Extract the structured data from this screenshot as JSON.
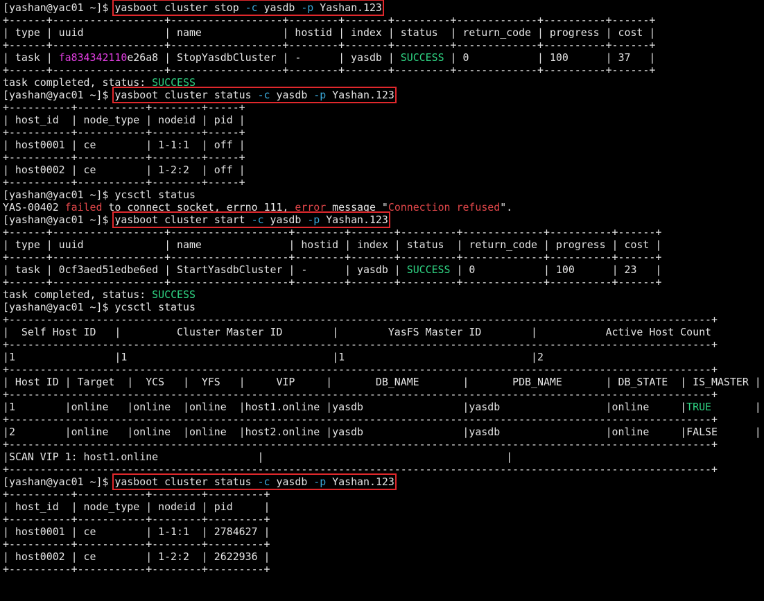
{
  "terminal": {
    "colors": {
      "background": "#000000",
      "foreground": "#e4e4e4",
      "magenta": "#e23ee2",
      "cyan": "#3aa8d8",
      "green": "#2fd483",
      "red": "#e2474a",
      "highlight_box": "#e0282c"
    },
    "lines": [
      [
        {
          "t": "[yashan@yac01 ~]$ "
        },
        {
          "t": "yasboot cluster stop ",
          "box": "s"
        },
        {
          "t": "-c",
          "c": "cyan",
          "box": "m"
        },
        {
          "t": " yasdb ",
          "box": "m"
        },
        {
          "t": "-p",
          "c": "cyan",
          "box": "m"
        },
        {
          "t": " Yashan.123",
          "box": "e"
        }
      ],
      [
        {
          "t": "+------+------------------+------------------+--------+-------+---------+-------------+----------+------+"
        }
      ],
      [
        {
          "t": "| type | uuid             | name             | hostid | index | status  | return_code | progress | cost |"
        }
      ],
      [
        {
          "t": "+------+------------------+------------------+--------+-------+---------+-------------+----------+------+"
        }
      ],
      [
        {
          "t": "| task | "
        },
        {
          "t": "fa834342110",
          "c": "magenta"
        },
        {
          "t": "e26a8 | StopYasdbCluster | -      | yasdb | "
        },
        {
          "t": "SUCCESS",
          "c": "green"
        },
        {
          "t": " | 0           | 100      | 37   |"
        }
      ],
      [
        {
          "t": "+------+------------------+------------------+--------+-------+---------+-------------+----------+------+"
        }
      ],
      [
        {
          "t": "task completed, status: "
        },
        {
          "t": "SUCCESS",
          "c": "green"
        }
      ],
      [
        {
          "t": "[yashan@yac01 ~]$ "
        },
        {
          "t": "yasboot cluster status ",
          "box": "s"
        },
        {
          "t": "-c",
          "c": "cyan",
          "box": "m"
        },
        {
          "t": " yasdb ",
          "box": "m"
        },
        {
          "t": "-p",
          "c": "cyan",
          "box": "m"
        },
        {
          "t": " Yashan.123",
          "box": "e"
        }
      ],
      [
        {
          "t": "+----------+-----------+--------+-----+"
        }
      ],
      [
        {
          "t": "| host_id  | node_type | nodeid | pid |"
        }
      ],
      [
        {
          "t": "+----------+-----------+--------+-----+"
        }
      ],
      [
        {
          "t": "| host0001 | ce        | 1-1:1  | off |"
        }
      ],
      [
        {
          "t": "+----------+-----------+--------+-----+"
        }
      ],
      [
        {
          "t": "| host0002 | ce        | 1-2:2  | off |"
        }
      ],
      [
        {
          "t": "+----------+-----------+--------+-----+"
        }
      ],
      [
        {
          "t": "[yashan@yac01 ~]$ ycsctl status"
        }
      ],
      [
        {
          "t": "YAS-00402 "
        },
        {
          "t": "failed",
          "c": "red"
        },
        {
          "t": " to connect socket, errno 111, "
        },
        {
          "t": "error",
          "c": "red"
        },
        {
          "t": " message \""
        },
        {
          "t": "Connection refused",
          "c": "red"
        },
        {
          "t": "\"."
        }
      ],
      [
        {
          "t": "[yashan@yac01 ~]$ "
        },
        {
          "t": "yasboot cluster start ",
          "box": "s"
        },
        {
          "t": "-c",
          "c": "cyan",
          "box": "m"
        },
        {
          "t": " yasdb ",
          "box": "m"
        },
        {
          "t": "-p",
          "c": "cyan",
          "box": "m"
        },
        {
          "t": " Yashan.123",
          "box": "e"
        }
      ],
      [
        {
          "t": "+------+------------------+-------------------+--------+-------+---------+-------------+----------+------+"
        }
      ],
      [
        {
          "t": "| type | uuid             | name              | hostid | index | status  | return_code | progress | cost |"
        }
      ],
      [
        {
          "t": "+------+------------------+-------------------+--------+-------+---------+-------------+----------+------+"
        }
      ],
      [
        {
          "t": "| task | 0cf3aed51edbe6ed | StartYasdbCluster | -      | yasdb | "
        },
        {
          "t": "SUCCESS",
          "c": "green"
        },
        {
          "t": " | 0           | 100      | 23   |"
        }
      ],
      [
        {
          "t": "+------+------------------+-------------------+--------+-------+---------+-------------+----------+------+"
        }
      ],
      [
        {
          "t": "task completed, status: "
        },
        {
          "t": "SUCCESS",
          "c": "green"
        }
      ],
      [
        {
          "t": "[yashan@yac01 ~]$ ycsctl status"
        }
      ],
      [
        {
          "t": "+-----------------------------------------------------------------------------------------------------------------+"
        }
      ],
      [
        {
          "t": "|  Self Host ID   |         Cluster Master ID        |        YasFS Master ID        |           Active Host Count          |"
        }
      ],
      [
        {
          "t": "+-----------------------------------------------------------------------------------------------------------------+"
        }
      ],
      [
        {
          "t": "|1                |1                                 |1                              |2                                     |"
        }
      ],
      [
        {
          "t": "+-----------------------------------------------------------------------------------------------------------------+"
        }
      ],
      [
        {
          "t": "| Host ID | Target  |  YCS   |  YFS   |     VIP     |       DB_NAME       |       PDB_NAME       | DB_STATE  | IS_MASTER |"
        }
      ],
      [
        {
          "t": "+-----------------------------------------------------------------------------------------------------------------+"
        }
      ],
      [
        {
          "t": "|1        |online   |online  |online  |host1.online |yasdb                |yasdb                 |online     |"
        },
        {
          "t": "TRUE",
          "c": "green"
        },
        {
          "t": "       |"
        }
      ],
      [
        {
          "t": "+-----------------------------------------------------------------------------------------------------------------+"
        }
      ],
      [
        {
          "t": "|2        |online   |online  |online  |host2.online |yasdb                |yasdb                 |online     |FALSE      |"
        }
      ],
      [
        {
          "t": "+-----------------------------------------------------------------------------------------------------------------+"
        }
      ],
      [
        {
          "t": "|SCAN VIP 1: host1.online                |                                       |                                         |"
        }
      ],
      [
        {
          "t": "+-----------------------------------------------------------------------------------------------------------------+"
        }
      ],
      [
        {
          "t": "[yashan@yac01 ~]$ "
        },
        {
          "t": "yasboot cluster status ",
          "box": "s"
        },
        {
          "t": "-c",
          "c": "cyan",
          "box": "m"
        },
        {
          "t": " yasdb ",
          "box": "m"
        },
        {
          "t": "-p",
          "c": "cyan",
          "box": "m"
        },
        {
          "t": " Yashan.123",
          "box": "e"
        }
      ],
      [
        {
          "t": "+----------+-----------+--------+---------+"
        }
      ],
      [
        {
          "t": "| host_id  | node_type | nodeid | pid     |"
        }
      ],
      [
        {
          "t": "+----------+-----------+--------+---------+"
        }
      ],
      [
        {
          "t": "| host0001 | ce        | 1-1:1  | 2784627 |"
        }
      ],
      [
        {
          "t": "+----------+-----------+--------+---------+"
        }
      ],
      [
        {
          "t": "| host0002 | ce        | 1-2:2  | 2622936 |"
        }
      ],
      [
        {
          "t": "+----------+-----------+--------+---------+"
        }
      ]
    ]
  }
}
